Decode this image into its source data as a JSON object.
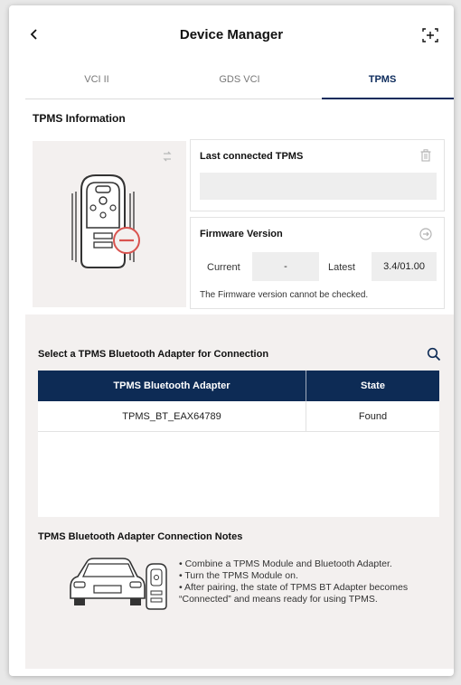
{
  "header": {
    "title": "Device Manager"
  },
  "tabs": [
    {
      "label": "VCI II",
      "active": false
    },
    {
      "label": "GDS VCI",
      "active": false
    },
    {
      "label": "TPMS",
      "active": true
    }
  ],
  "info": {
    "section_title": "TPMS Information",
    "last_connected_title": "Last connected TPMS",
    "last_connected_value": "",
    "firmware_title": "Firmware Version",
    "current_label": "Current",
    "current_value": "-",
    "latest_label": "Latest",
    "latest_value": "3.4/01.00",
    "firmware_note": "The Firmware version cannot be checked."
  },
  "adapter": {
    "section_title": "Select a TPMS Bluetooth Adapter for Connection",
    "columns": [
      "TPMS Bluetooth Adapter",
      "State"
    ],
    "rows": [
      {
        "name": "TPMS_BT_EAX64789",
        "state": "Found"
      }
    ]
  },
  "notes": {
    "title": "TPMS Bluetooth Adapter Connection Notes",
    "lines": [
      "• Combine a TPMS Module and Bluetooth Adapter.",
      "• Turn the TPMS Module on.",
      "• After pairing, the state of TPMS BT Adapter becomes “Connected” and means ready for using TPMS."
    ]
  },
  "colors": {
    "primary": "#0d2b55",
    "panel": "#f3f0ef",
    "status_red": "#d9534f"
  },
  "icons": [
    "back-arrow-icon",
    "connect-device-icon",
    "refresh-icon",
    "trash-icon",
    "firmware-update-icon",
    "search-icon"
  ]
}
